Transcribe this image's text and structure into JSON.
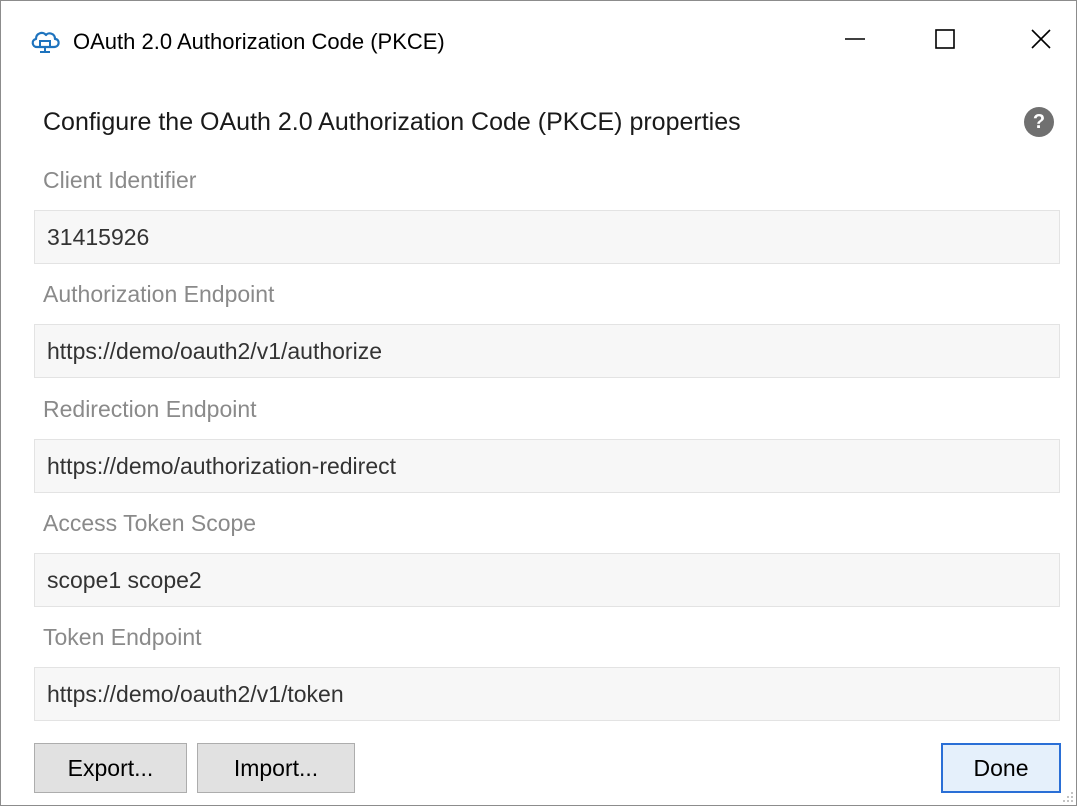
{
  "window": {
    "title": "OAuth 2.0 Authorization Code (PKCE)",
    "icon": "cloud-icon",
    "controls": {
      "minimize": "minimize-icon",
      "maximize": "maximize-icon",
      "close": "close-icon"
    }
  },
  "heading": "Configure the OAuth 2.0 Authorization Code (PKCE) properties",
  "help": {
    "glyph": "?",
    "icon": "help-icon"
  },
  "fields": [
    {
      "label": "Client Identifier",
      "value": "31415926"
    },
    {
      "label": "Authorization Endpoint",
      "value": "https://demo/oauth2/v1/authorize"
    },
    {
      "label": "Redirection Endpoint",
      "value": "https://demo/authorization-redirect"
    },
    {
      "label": "Access Token Scope",
      "value": "scope1 scope2"
    },
    {
      "label": "Token Endpoint",
      "value": "https://demo/oauth2/v1/token"
    }
  ],
  "buttons": {
    "export": "Export...",
    "import": "Import...",
    "done": "Done"
  },
  "colors": {
    "accent": "#2a6fd6",
    "icon_blue": "#1e73be",
    "label_gray": "#8a8a8a",
    "field_bg": "#f7f7f7"
  }
}
